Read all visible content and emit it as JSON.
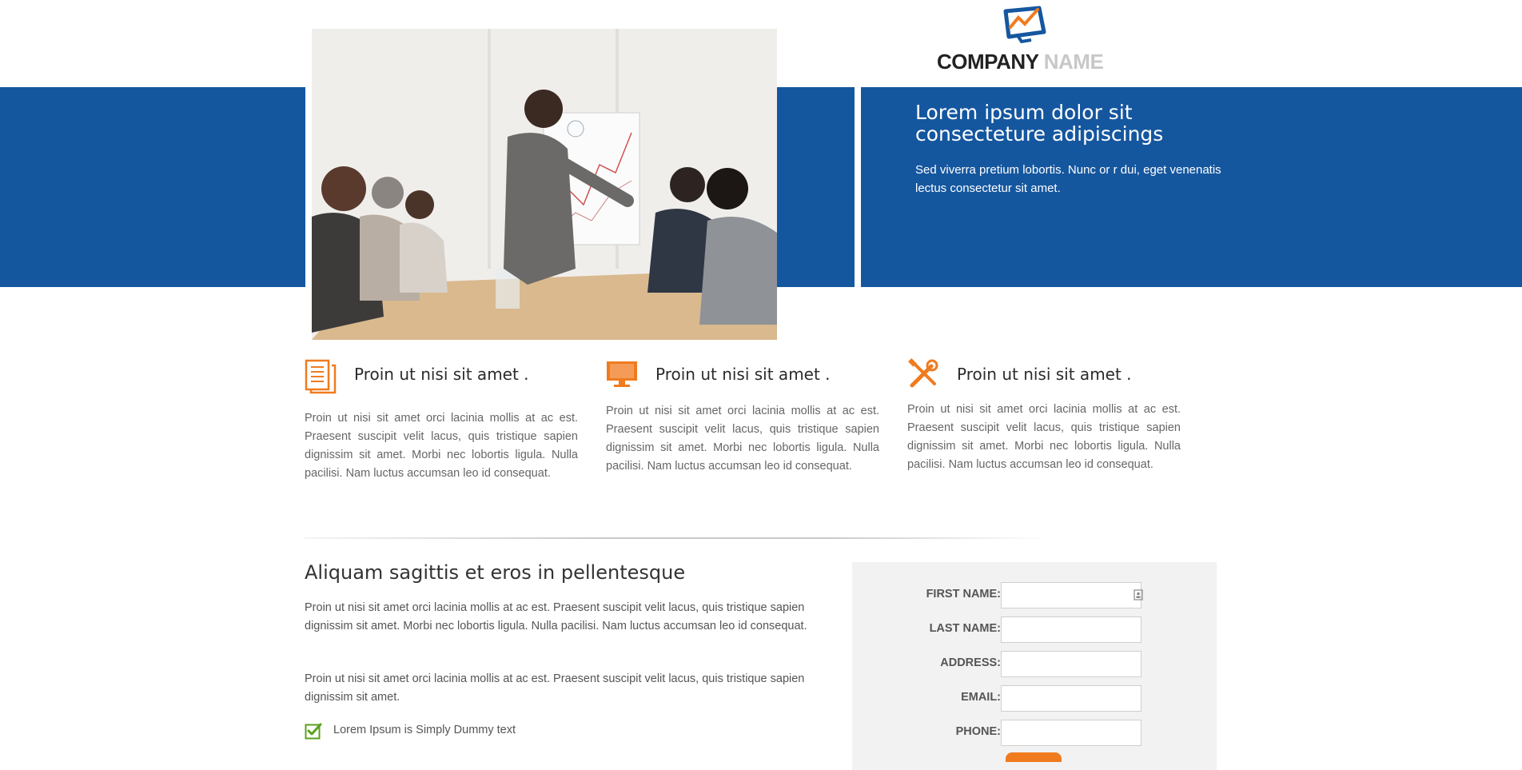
{
  "header": {
    "logo_primary": "COMPANY",
    "logo_secondary": "NAME",
    "brand_color": "#15579f",
    "accent_color": "#f07b1f"
  },
  "hero": {
    "image_icon": "business-presentation-photo",
    "title": "Lorem ipsum dolor sit consecteture adipiscings",
    "text": "Sed viverra pretium lobortis. Nunc or r dui, eget venenatis lectus consectetur sit amet."
  },
  "features": [
    {
      "icon": "document-icon",
      "title": "Proin ut nisi sit amet .",
      "text": "Proin ut nisi sit amet orci lacinia mollis at ac est. Praesent suscipit velit lacus, quis tristique sapien dignissim sit amet. Morbi nec lobortis ligula. Nulla pacilisi. Nam luctus accumsan leo id consequat."
    },
    {
      "icon": "monitor-icon",
      "title": "Proin ut nisi sit amet .",
      "text": "Proin ut nisi sit amet orci lacinia mollis at ac est. Praesent suscipit velit lacus, quis tristique sapien dignissim sit amet. Morbi nec lobortis ligula. Nulla pacilisi. Nam luctus accumsan leo id consequat."
    },
    {
      "icon": "tools-icon",
      "title": "Proin ut nisi sit amet .",
      "text": "Proin ut nisi sit amet orci lacinia mollis at ac est. Praesent suscipit velit lacus, quis tristique sapien dignissim sit amet. Morbi nec lobortis ligula. Nulla pacilisi. Nam luctus accumsan leo id consequat."
    }
  ],
  "content": {
    "title": "Aliquam sagittis et eros in pellentesque",
    "paragraph_1": "Proin ut nisi sit amet orci lacinia mollis at ac est. Praesent suscipit velit lacus, quis tristique sapien dignissim sit amet. Morbi nec lobortis ligula. Nulla pacilisi. Nam luctus accumsan leo id consequat.",
    "paragraph_2": "Proin ut nisi sit amet orci lacinia mollis at ac est. Praesent suscipit velit lacus, quis tristique sapien dignissim sit amet.",
    "check_item": "Lorem Ipsum is Simply Dummy text",
    "check_color": "#5aa01e"
  },
  "form": {
    "fields": [
      {
        "label": "FIRST NAME:",
        "value": ""
      },
      {
        "label": "LAST NAME:",
        "value": ""
      },
      {
        "label": "ADDRESS:",
        "value": ""
      },
      {
        "label": "EMAIL:",
        "value": ""
      },
      {
        "label": "PHONE:",
        "value": ""
      }
    ]
  }
}
